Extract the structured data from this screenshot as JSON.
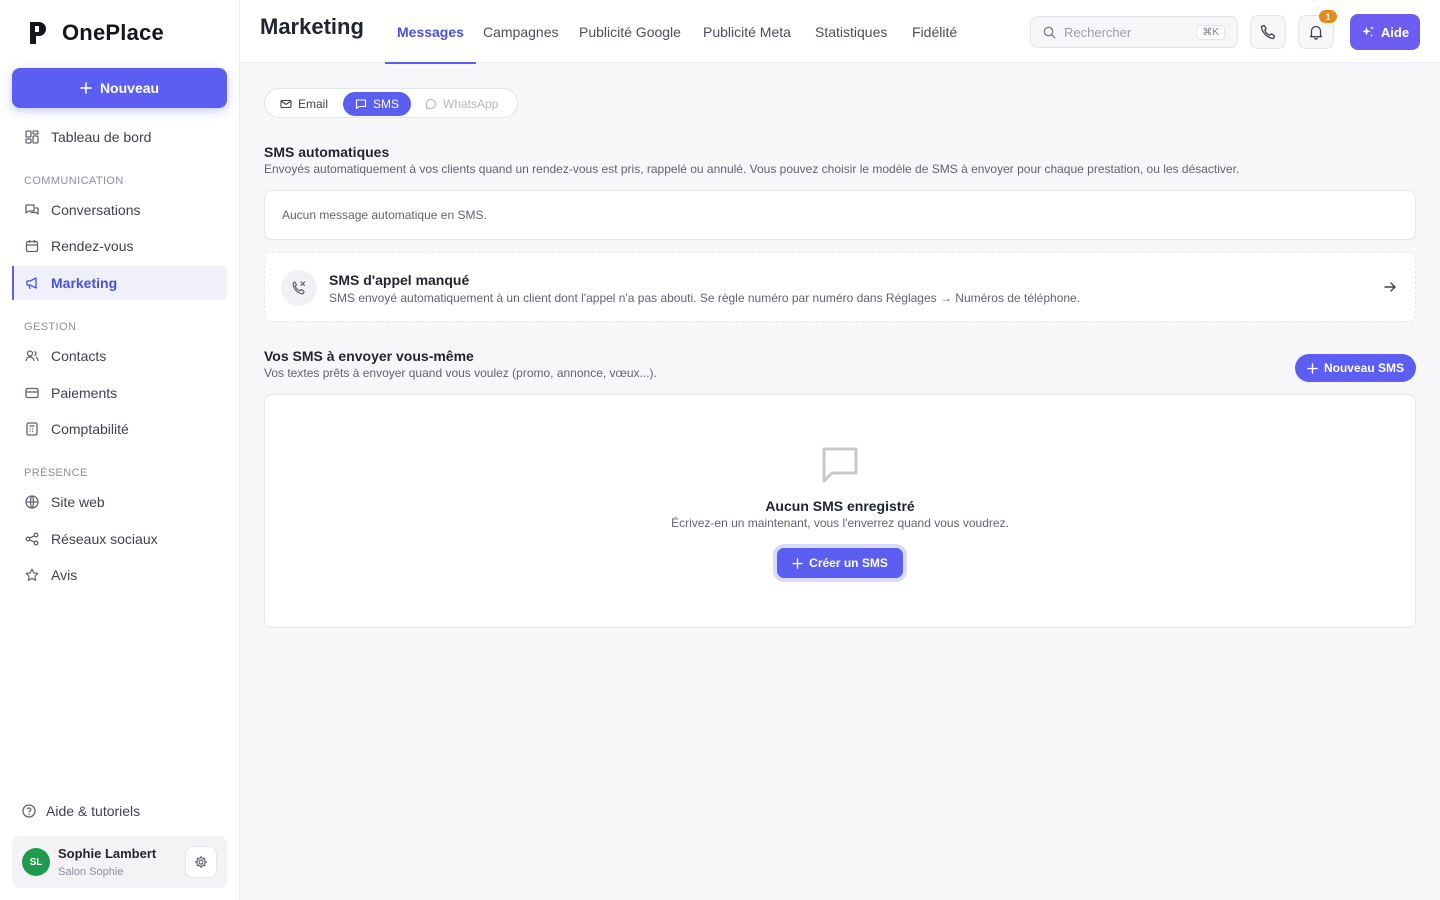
{
  "app": {
    "name": "OnePlace",
    "colors": {
      "accent": "#5b5ef0",
      "badge": "#e38b1c",
      "avatar": "#1f9a4e"
    }
  },
  "sidebar": {
    "new_button": "Nouveau",
    "dashboard": {
      "label": "Tableau de bord",
      "icon": "dashboard-icon"
    },
    "sections": {
      "communication": "COMMUNICATION",
      "gestion": "GESTION",
      "presence": "PRÉSENCE"
    },
    "items": [
      {
        "label": "Conversations",
        "icon": "conversations-icon"
      },
      {
        "label": "Rendez-vous",
        "icon": "calendar-icon"
      },
      {
        "label": "Marketing",
        "icon": "megaphone-icon",
        "active": true
      },
      {
        "label": "Contacts",
        "icon": "users-icon"
      },
      {
        "label": "Paiements",
        "icon": "credit-card-icon"
      },
      {
        "label": "Comptabilité",
        "icon": "calculator-icon"
      },
      {
        "label": "Site web",
        "icon": "globe-icon"
      },
      {
        "label": "Réseaux sociaux",
        "icon": "share-icon"
      },
      {
        "label": "Avis",
        "icon": "star-icon"
      }
    ],
    "help": "Aide & tutoriels",
    "user": {
      "initials": "SL",
      "name": "Sophie Lambert",
      "business": "Salon Sophie"
    }
  },
  "header": {
    "title": "Marketing",
    "tabs": [
      {
        "label": "Messages",
        "active": true
      },
      {
        "label": "Campagnes"
      },
      {
        "label": "Publicité Google"
      },
      {
        "label": "Publicité Meta"
      },
      {
        "label": "Statistiques"
      },
      {
        "label": "Fidélité"
      }
    ],
    "search": {
      "placeholder": "Rechercher",
      "shortcut": "⌘K"
    },
    "notifications_count": "1",
    "help_button": "Aide"
  },
  "main": {
    "channel_tabs": [
      {
        "label": "Email"
      },
      {
        "label": "SMS",
        "active": true
      },
      {
        "label": "WhatsApp",
        "disabled": true
      }
    ],
    "auto_section": {
      "title": "SMS automatiques",
      "description": "Envoyés automatiquement à vos clients quand un rendez-vous est pris, rappelé ou annulé. Vous pouvez choisir le modèle de SMS à envoyer pour chaque prestation, ou les désactiver.",
      "empty": "Aucun message automatique en SMS."
    },
    "missed_call": {
      "title": "SMS d'appel manqué",
      "description": "SMS envoyé automatiquement à un client dont l'appel n'a pas abouti. Se règle numéro par numéro dans Réglages → Numéros de téléphone."
    },
    "manual_section": {
      "title": "Vos SMS à envoyer vous-même",
      "description": "Vos textes prêts à envoyer quand vous voulez (promo, annonce, vœux...).",
      "new_button": "Nouveau SMS",
      "empty_title": "Aucun SMS enregistré",
      "empty_desc": "Écrivez-en un maintenant, vous l'enverrez quand vous voudrez.",
      "create_button": "Créer un SMS"
    }
  }
}
